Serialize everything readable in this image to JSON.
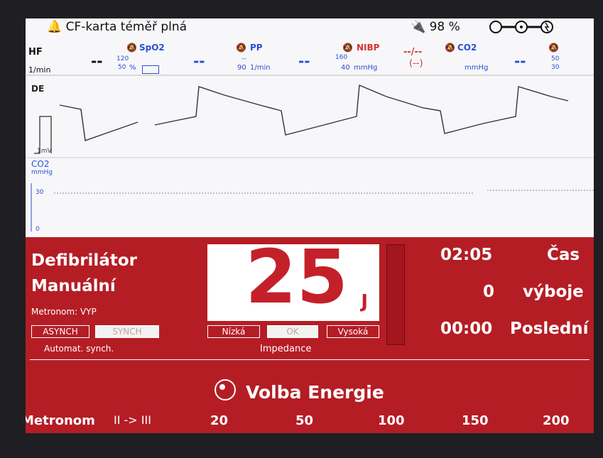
{
  "status": {
    "warning": "CF-karta téměř plná",
    "battery": "98 %"
  },
  "vitals": {
    "hf": {
      "label": "HF",
      "unit": "1/min",
      "value": "--"
    },
    "spo2": {
      "label": "SpO2",
      "upper": "120",
      "lower": "50",
      "unit": "%",
      "value": "--"
    },
    "pp": {
      "label": "PP",
      "upper": "--",
      "lower": "90",
      "unit": "1/min",
      "value": "--"
    },
    "nibp": {
      "label": "NIBP",
      "upper": "160",
      "lower": "40",
      "unit": "mmHg",
      "value": "--/--",
      "sub": "(--)"
    },
    "co2": {
      "label": "CO2",
      "unit": "mmHg",
      "value": "--",
      "upper": "50",
      "lower": "30"
    }
  },
  "waves": {
    "ecg_label": "DE",
    "ecg_scale": "1mV",
    "co2_label": "CO2",
    "co2_unit": "mmHg",
    "co2_ref": "30",
    "co2_zero": "0"
  },
  "defib": {
    "title1": "Defibrilátor",
    "title2": "Manuální",
    "metronome": "Metronom: VYP",
    "asynch": "ASYNCH",
    "synch": "SYNCH",
    "auto_synch": "Automat. synch.",
    "energy_value": "25",
    "energy_unit": "J",
    "imp_low": "Nízká",
    "imp_ok": "OK",
    "imp_high": "Vysoká",
    "impedance": "Impedance",
    "time_value": "02:05",
    "time_label": "Čas",
    "shocks_value": "0",
    "shocks_label": "výboje",
    "last_value": "00:00",
    "last_label": "Poslední",
    "select_energy": "Volba Energie"
  },
  "bottom": {
    "metronom": "Metronom",
    "lead": "II -> III",
    "scale": [
      "20",
      "50",
      "100",
      "150",
      "200"
    ]
  },
  "colors": {
    "panel": "#b51d25",
    "accent_blue": "#2a4fd0",
    "energy_red": "#c4202a"
  }
}
